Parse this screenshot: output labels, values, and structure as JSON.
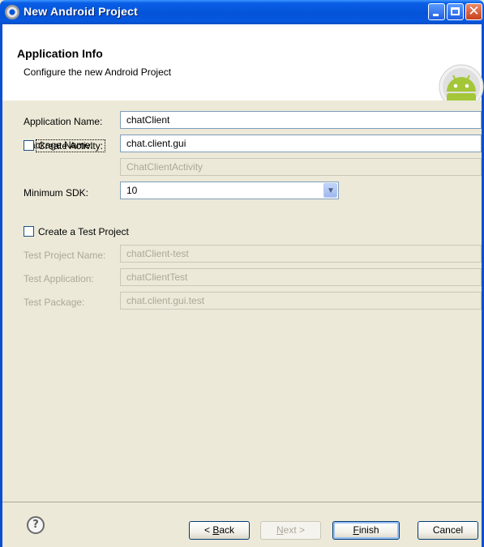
{
  "window": {
    "title": "New Android Project"
  },
  "banner": {
    "title": "Application Info",
    "subtitle": "Configure the new Android Project",
    "icon": "android-logo"
  },
  "form": {
    "app_name_label": "Application Name:",
    "app_name_value": "chatClient",
    "package_label": "Package Name:",
    "package_value": "chat.client.gui",
    "create_activity_label": "Create Activity:",
    "create_activity_checked": false,
    "activity_value": "ChatClientActivity",
    "min_sdk_label": "Minimum SDK:",
    "min_sdk_value": "10",
    "create_test_label": "Create a Test Project",
    "create_test_checked": false,
    "test_project_name_label": "Test Project Name:",
    "test_project_name_value": "chatClient-test",
    "test_app_label": "Test Application:",
    "test_app_value": "chatClientTest",
    "test_package_label": "Test Package:",
    "test_package_value": "chat.client.gui.test"
  },
  "buttons": {
    "back_prefix": "< ",
    "back_key": "B",
    "back_rest": "ack",
    "next_key": "N",
    "next_rest": "ext >",
    "finish_key": "F",
    "finish_rest": "inish",
    "cancel": "Cancel"
  },
  "colors": {
    "titlebar": "#0453d8",
    "dialog_bg": "#ece9d8",
    "android_green": "#a4c639"
  }
}
